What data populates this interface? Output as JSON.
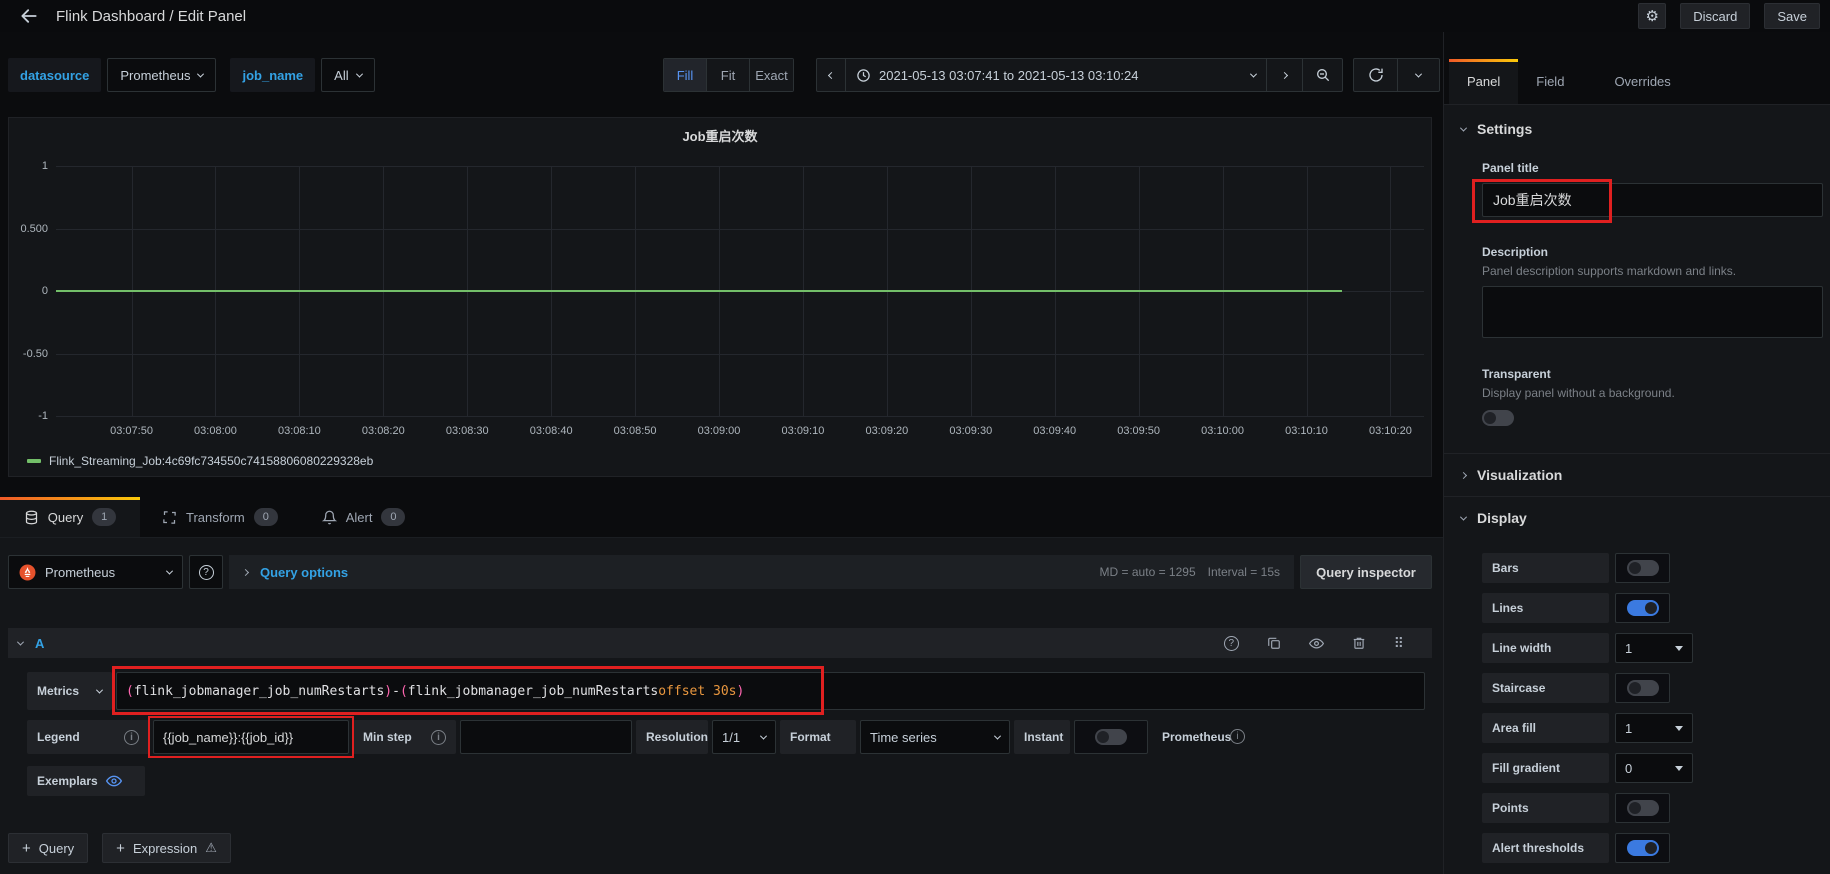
{
  "header": {
    "title": "Flink Dashboard / Edit Panel",
    "discard": "Discard",
    "save": "Save"
  },
  "toolbar": {
    "variables": [
      {
        "label": "datasource",
        "value": "Prometheus"
      },
      {
        "label": "job_name",
        "value": "All"
      }
    ],
    "fit_options": [
      "Fill",
      "Fit",
      "Exact"
    ],
    "fit_active": "Fill",
    "time_range": "2021-05-13 03:07:41 to 2021-05-13 03:10:24"
  },
  "chart_data": {
    "type": "line",
    "title": "Job重启次数",
    "x_range": [
      "03:07:41",
      "03:10:24"
    ],
    "x_ticks": [
      "03:07:50",
      "03:08:00",
      "03:08:10",
      "03:08:20",
      "03:08:30",
      "03:08:40",
      "03:08:50",
      "03:09:00",
      "03:09:10",
      "03:09:20",
      "03:09:30",
      "03:09:40",
      "03:09:50",
      "03:10:00",
      "03:10:10",
      "03:10:20"
    ],
    "y_ticks": [
      "1",
      "0.500",
      "0",
      "-0.50",
      "-1"
    ],
    "ylim": [
      -1,
      1
    ],
    "grid": true,
    "legend_position": "bottom-left",
    "series": [
      {
        "name": "Flink_Streaming_Job:4c69fc734550c74158806080229328eb",
        "color": "#73BF69",
        "values": [
          0,
          0,
          0,
          0,
          0,
          0,
          0,
          0,
          0,
          0,
          0,
          0,
          0,
          0,
          0,
          0
        ]
      }
    ]
  },
  "editor_tabs": [
    {
      "label": "Query",
      "badge": "1"
    },
    {
      "label": "Transform",
      "badge": "0"
    },
    {
      "label": "Alert",
      "badge": "0"
    }
  ],
  "query": {
    "datasource": "Prometheus",
    "options_label": "Query options",
    "max_data_points": "MD = auto = 1295",
    "interval": "Interval = 15s",
    "inspector_label": "Query inspector",
    "ref_id": "A",
    "metrics_label": "Metrics",
    "expression": "(flink_jobmanager_job_numRestarts)-(flink_jobmanager_job_numRestarts offset 30s)",
    "expr_tokens": [
      {
        "text": "(",
        "type": "paren"
      },
      {
        "text": "flink_jobmanager_job_numRestarts",
        "type": "plain"
      },
      {
        "text": ")",
        "type": "paren"
      },
      {
        "text": "-",
        "type": "plain"
      },
      {
        "text": "(",
        "type": "paren"
      },
      {
        "text": "flink_jobmanager_job_numRestarts ",
        "type": "plain"
      },
      {
        "text": "offset 30s",
        "type": "keyword"
      },
      {
        "text": ")",
        "type": "paren"
      }
    ],
    "legend_label": "Legend",
    "legend_value": "{{job_name}}:{{job_id}}",
    "min_step_label": "Min step",
    "min_step_value": "",
    "resolution_label": "Resolution",
    "resolution_value": "1/1",
    "format_label": "Format",
    "format_value": "Time series",
    "instant_label": "Instant",
    "instant_on": false,
    "datasource_hint": "Prometheus",
    "exemplars_label": "Exemplars",
    "add_query_label": "Query",
    "add_expression_label": "Expression"
  },
  "sidebar": {
    "tabs": [
      "Panel",
      "Field",
      "Overrides"
    ],
    "active_tab": "Panel",
    "settings": {
      "heading": "Settings",
      "panel_title_label": "Panel title",
      "panel_title_value": "Job重启次数",
      "description_label": "Description",
      "description_hint": "Panel description supports markdown and links.",
      "description_value": "",
      "transparent_label": "Transparent",
      "transparent_hint": "Display panel without a background.",
      "transparent_on": false
    },
    "visualization_heading": "Visualization",
    "display": {
      "heading": "Display",
      "rows": [
        {
          "label": "Bars",
          "type": "toggle",
          "on": false
        },
        {
          "label": "Lines",
          "type": "toggle",
          "on": true
        },
        {
          "label": "Line width",
          "type": "select",
          "value": "1"
        },
        {
          "label": "Staircase",
          "type": "toggle",
          "on": false
        },
        {
          "label": "Area fill",
          "type": "select",
          "value": "1"
        },
        {
          "label": "Fill gradient",
          "type": "select",
          "value": "0"
        },
        {
          "label": "Points",
          "type": "toggle",
          "on": false
        },
        {
          "label": "Alert thresholds",
          "type": "toggle",
          "on": true
        }
      ]
    }
  },
  "icons": {
    "gear": "⚙",
    "help": "?",
    "info": "i",
    "warning": "⚠",
    "grip": "⠿",
    "plus": "+"
  },
  "colors": {
    "series_green": "#73BF69",
    "annotation_red": "#e02020",
    "toggle_on_blue": "#3b7ae0",
    "link_blue": "#33a2e5",
    "active_blue": "#5794F2",
    "tab_gradient": [
      "#f05a28",
      "#fbca0a"
    ],
    "expr_paren": "#ff66b0",
    "expr_keyword": "#e9973f"
  }
}
